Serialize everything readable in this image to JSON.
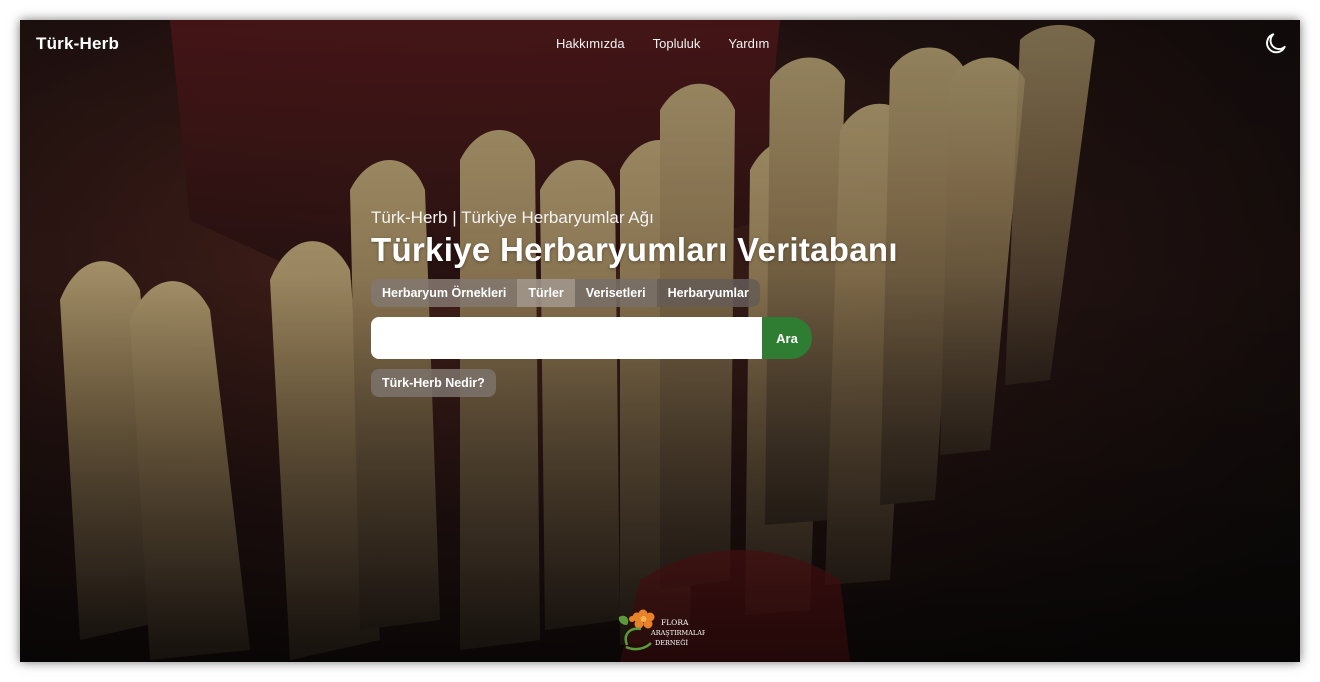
{
  "brand": "Türk-Herb",
  "nav": {
    "items": [
      "Hakkımızda",
      "Topluluk",
      "Yardım"
    ]
  },
  "icons": {
    "theme_toggle": "moon-icon",
    "footer_logo": "flora-logo"
  },
  "hero": {
    "subtitle": "Türk-Herb | Türkiye Herbaryumlar Ağı",
    "title": "Türkiye Herbaryumları Veritabanı",
    "tabs": [
      "Herbaryum Örnekleri",
      "Türler",
      "Verisetleri",
      "Herbaryumlar"
    ],
    "search": {
      "value": "",
      "placeholder": "",
      "button": "Ara"
    },
    "about": "Türk-Herb Nedir?"
  },
  "footer": {
    "logo_text": [
      "FLORA",
      "ARAŞTIRMALARI",
      "DERNEĞİ"
    ]
  },
  "colors": {
    "accent": "#2e7d32",
    "text": "#ffffff",
    "logo_orange": "#e8822a",
    "logo_green": "#5a9a3a"
  }
}
